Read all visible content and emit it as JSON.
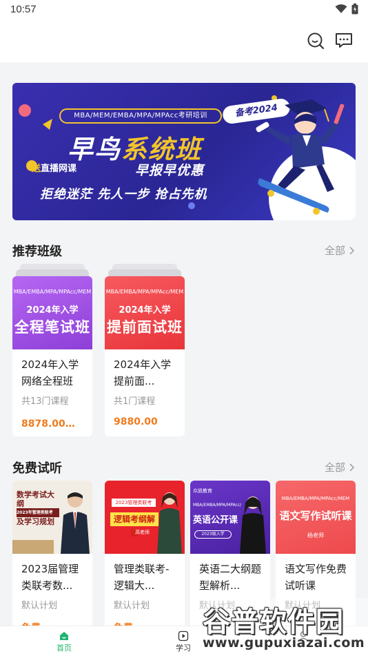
{
  "status_bar": {
    "time": "10:57"
  },
  "top_bar": {
    "search_icon": "search-icon",
    "message_icon": "message-icon"
  },
  "banner": {
    "pill_text": "MBA/MEM/EMBA/MPA/MPAcc考研培训",
    "tag": "备考2024",
    "title_a": "早鸟",
    "title_b": "系统班",
    "gift_a": "送",
    "gift_b": "直播网课",
    "subtitle": "早报早优惠",
    "slogan": "拒绝迷茫  先人一步  抢占先机"
  },
  "recommended": {
    "title": "推荐班级",
    "more": "全部",
    "cards": [
      {
        "thumb_top": "MBA/EMBA/MPA/MPAcc/MEM",
        "thumb_year": "2024年入学",
        "thumb_big": "全程笔试班",
        "title": "2024年入学网络全程班",
        "sub": "共13门课程",
        "price": "8878.00众...",
        "color": "#a155e6"
      },
      {
        "thumb_top": "MBA/EMBA/MPA/MPAcc/MEM",
        "thumb_year": "2024年入学",
        "thumb_big": "提前面试班",
        "title": "2024年入学提前面...",
        "sub": "共1门课程",
        "price": "9880.00",
        "color": "#f2464a"
      }
    ]
  },
  "free_trial": {
    "title": "免费试听",
    "more": "全部",
    "cards": [
      {
        "thumb_lines": [
          "数学考试大纲",
          "2023年管理类联考",
          "及学习规划"
        ],
        "title": "2023届管理类联考数...",
        "sub": "默认计划",
        "price": "免费",
        "color": "#f2ede4"
      },
      {
        "thumb_lines": [
          "2023管理类联考",
          "逻辑考纲解读",
          "高老师"
        ],
        "title": "管理类联考-逻辑大...",
        "sub": "默认计划",
        "price": "免费",
        "color": "#e8232c"
      },
      {
        "thumb_lines": [
          "众凯教育",
          "MBA/EMBA/MPA/MPAcc/MEM",
          "英语公开课",
          "2023级入学"
        ],
        "title": "英语二大纲题型解析...",
        "sub": "默认计划",
        "price": "",
        "color": "#5b2bb5"
      },
      {
        "thumb_lines": [
          "MBA/EMBA/MPA/MPAcc/MEM",
          "语文写作试听课",
          "杨老师"
        ],
        "title": "语文写作免费试听课",
        "sub": "默认计划",
        "price": "",
        "color": "#f2585a"
      }
    ]
  },
  "bottom_nav": {
    "items": [
      {
        "label": "首页",
        "icon": "home-icon",
        "active": true
      },
      {
        "label": "学习",
        "icon": "play-icon",
        "active": false
      },
      {
        "label": "",
        "icon": "profile-icon",
        "active": false
      }
    ]
  },
  "watermark": {
    "main": "谷普软件园",
    "url": "www.gupuxiazai.com"
  },
  "colors": {
    "accent": "#22b46e",
    "price": "#f07b1e",
    "banner": "#2a2694"
  }
}
